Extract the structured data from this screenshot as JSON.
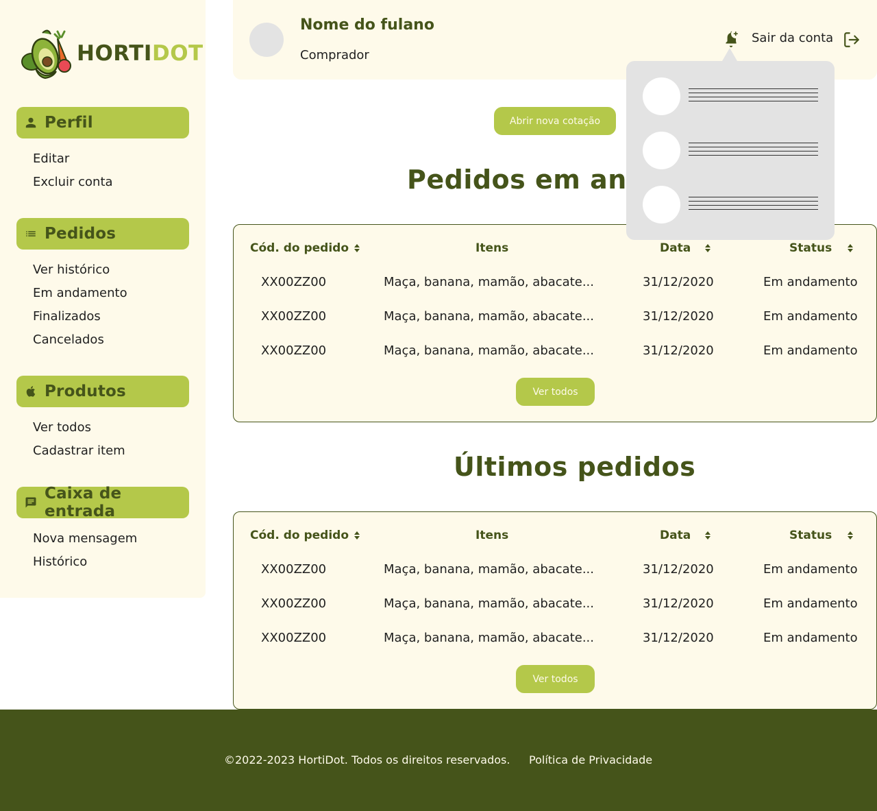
{
  "brand": {
    "name_part1": "HORTI",
    "name_part2": "DOT",
    "logo_icon": "vegetables-basket-logo"
  },
  "colors": {
    "primary": "#45541a",
    "accent": "#b4c84a",
    "cream": "#fefaea",
    "popup": "#e3e3e3"
  },
  "sidebar": {
    "sections": [
      {
        "icon": "person-icon",
        "title": "Perfil",
        "items": [
          "Editar",
          "Excluir conta"
        ]
      },
      {
        "icon": "list-icon",
        "title": "Pedidos",
        "items": [
          "Ver histórico",
          "Em andamento",
          "Finalizados",
          "Cancelados"
        ]
      },
      {
        "icon": "apple-icon",
        "title": "Produtos",
        "items": [
          "Ver todos",
          "Cadastrar item"
        ]
      },
      {
        "icon": "message-icon",
        "title": "Caixa de entrada",
        "items": [
          "Nova mensagem",
          "Histórico"
        ]
      }
    ]
  },
  "header": {
    "user_name": "Nome do fulano",
    "user_role": "Comprador",
    "notification_icon": "bell-plus-icon",
    "logout_label": "Sair da conta",
    "logout_icon": "logout-icon"
  },
  "actions": {
    "new_quote": "Abrir nova cotação"
  },
  "sections": {
    "in_progress": {
      "title": "Pedidos em andamento",
      "columns": [
        "Cód. do pedido",
        "Itens",
        "Data",
        "Status"
      ],
      "rows": [
        [
          "XX00ZZ00",
          "Maça, banana, mamão, abacate...",
          "31/12/2020",
          "Em andamento"
        ],
        [
          "XX00ZZ00",
          "Maça, banana, mamão, abacate...",
          "31/12/2020",
          "Em andamento"
        ],
        [
          "XX00ZZ00",
          "Maça, banana, mamão, abacate...",
          "31/12/2020",
          "Em andamento"
        ]
      ],
      "see_all": "Ver todos"
    },
    "latest": {
      "title": "Últimos pedidos",
      "columns": [
        "Cód. do pedido",
        "Itens",
        "Data",
        "Status"
      ],
      "rows": [
        [
          "XX00ZZ00",
          "Maça, banana, mamão, abacate...",
          "31/12/2020",
          "Em andamento"
        ],
        [
          "XX00ZZ00",
          "Maça, banana, mamão, abacate...",
          "31/12/2020",
          "Em andamento"
        ],
        [
          "XX00ZZ00",
          "Maça, banana, mamão, abacate...",
          "31/12/2020",
          "Em andamento"
        ]
      ],
      "see_all": "Ver todos"
    }
  },
  "footer": {
    "copyright": "©2022-2023 HortiDot. Todos os direitos reservados.",
    "privacy": "Política de Privacidade"
  }
}
